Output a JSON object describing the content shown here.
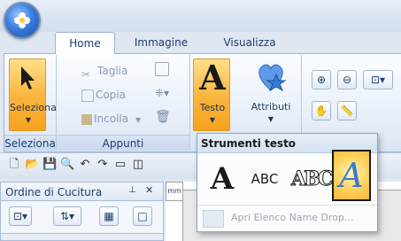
{
  "tabs": [
    {
      "label": "Home"
    },
    {
      "label": "Immagine"
    },
    {
      "label": "Visualizza"
    }
  ],
  "ribbon": {
    "seleziona": {
      "button_label": "Seleziona",
      "group_label": "Seleziona"
    },
    "appunti": {
      "group_label": "Appunti",
      "taglia": "Taglia",
      "copia": "Copia",
      "incolla": "Incolla"
    },
    "testo": {
      "button_label": "Testo"
    },
    "attributi": {
      "button_label": "Attributi"
    }
  },
  "dropdown": {
    "title": "Strumenti testo",
    "options": [
      {
        "icon": "serif-A-icon",
        "text": "A"
      },
      {
        "icon": "abc-icon",
        "text": "ABC"
      },
      {
        "icon": "monogram-icon",
        "text": "ABC"
      },
      {
        "icon": "decorative-A-icon",
        "text": "A"
      }
    ],
    "bottom_label": "Apri Elenco Name Drop..."
  },
  "panel": {
    "title": "Ordine di Cucitura",
    "pin": "⬚",
    "close": "✕"
  },
  "canvas": {
    "ruler_unit": "mm"
  },
  "colors": {
    "accent_orange": "#f9b43b",
    "ribbon_blue": "#dbe6f4",
    "text_blue": "#1e3d6b"
  }
}
